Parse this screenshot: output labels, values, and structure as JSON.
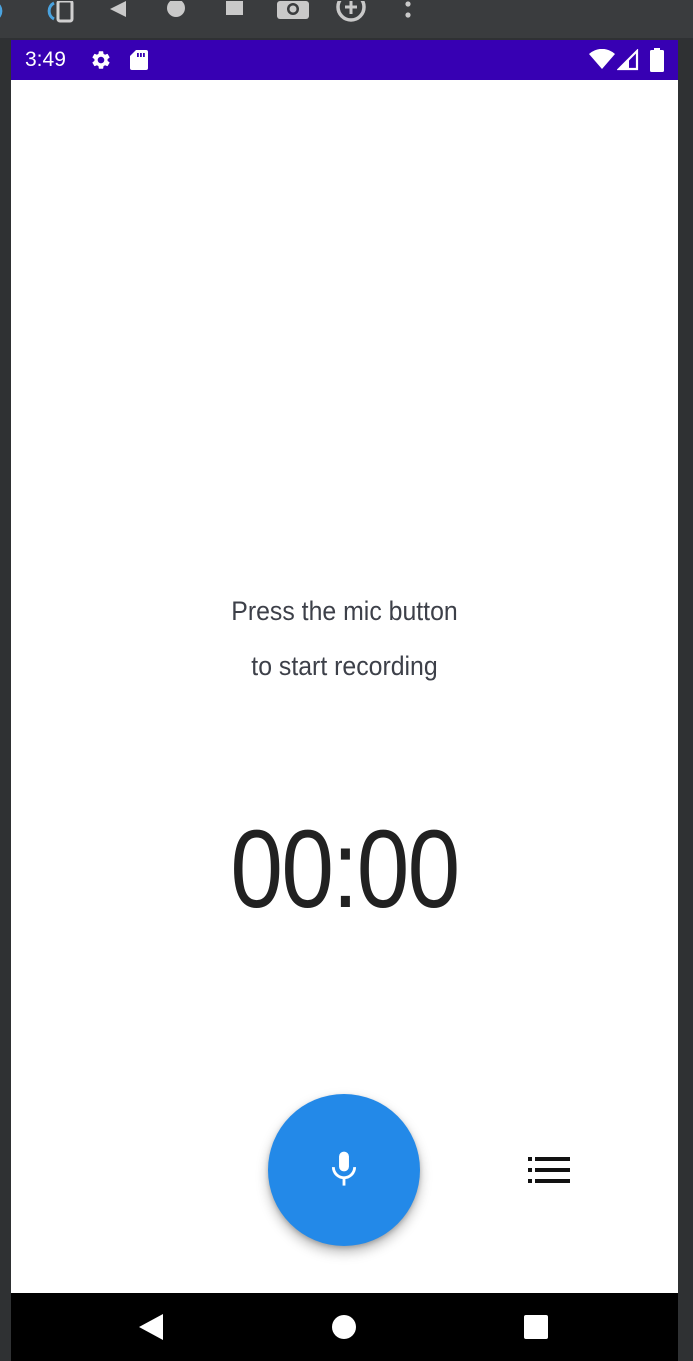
{
  "emulator_toolbar": {
    "icons": [
      "rotate-left-icon",
      "rotate-right-icon",
      "back-icon",
      "home-icon",
      "overview-icon",
      "camera-icon",
      "zoom-icon",
      "more-icon"
    ]
  },
  "status_bar": {
    "time": "3:49",
    "color": "#3700b3",
    "icons": [
      "settings-icon",
      "sd-card-icon",
      "wifi-icon",
      "signal-icon",
      "battery-icon"
    ]
  },
  "main": {
    "prompt_line_1": "Press the mic button",
    "prompt_line_2": "to start recording",
    "timer": "00:00"
  },
  "actions": {
    "record_icon": "microphone-icon",
    "record_color": "#2389e8",
    "list_icon": "list-icon"
  },
  "nav_bar": {
    "icons": [
      "back-triangle-icon",
      "home-circle-icon",
      "recents-square-icon"
    ]
  }
}
